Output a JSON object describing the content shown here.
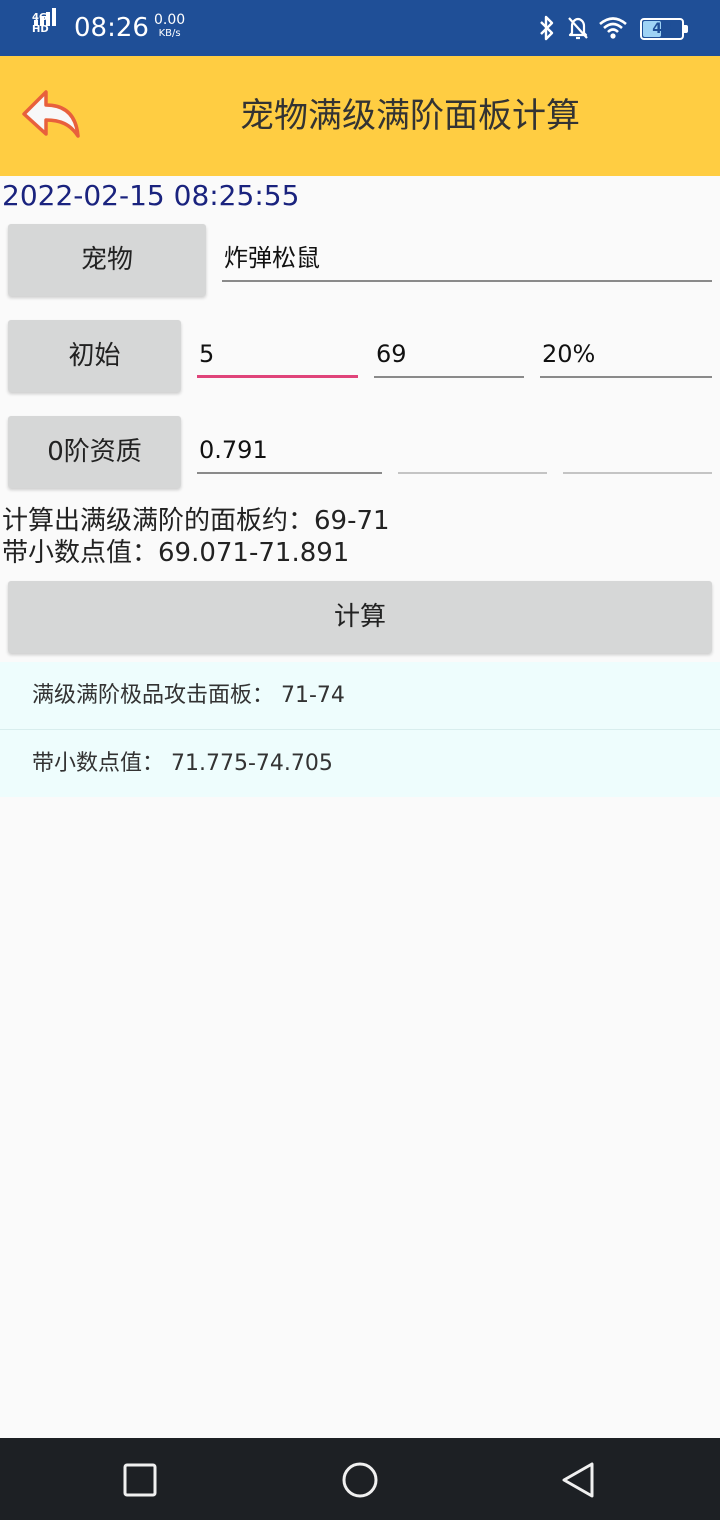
{
  "status_bar": {
    "network_type": "4G HD",
    "time": "08:26",
    "speed_value": "0.00",
    "speed_unit": "KB/s",
    "battery_level": "48",
    "battery_fraction": 0.48,
    "icons": [
      "bluetooth-icon",
      "bell-off-icon",
      "wifi-icon",
      "battery-icon"
    ]
  },
  "toolbar": {
    "title": "宠物满级满阶面板计算",
    "back_icon": "back-arrow-icon"
  },
  "datetime": "2022-02-15 08:25:55",
  "pet_row": {
    "button_label": "宠物",
    "value": "炸弹松鼠"
  },
  "initial_row": {
    "button_label": "初始",
    "values": [
      "5",
      "69",
      "20%"
    ]
  },
  "quality_row": {
    "button_label": "0阶资质",
    "values": [
      "0.791",
      "",
      ""
    ]
  },
  "results": {
    "panel_line": "计算出满级满阶的面板约：69-71",
    "decimal_line": "带小数点值：69.071-71.891"
  },
  "calculate_button": "计算",
  "list": [
    {
      "text": "满级满阶极品攻击面板：  71-74"
    },
    {
      "text": "带小数点值：  71.775-74.705"
    }
  ],
  "nav": {
    "icons": [
      "recent-apps-icon",
      "home-icon",
      "back-icon"
    ]
  },
  "colors": {
    "status_bar": "#1f4f97",
    "toolbar": "#ffcd42",
    "focus_underline": "#e0447a",
    "list_background": "#eefdfd",
    "datetime_text": "#1a237e"
  }
}
